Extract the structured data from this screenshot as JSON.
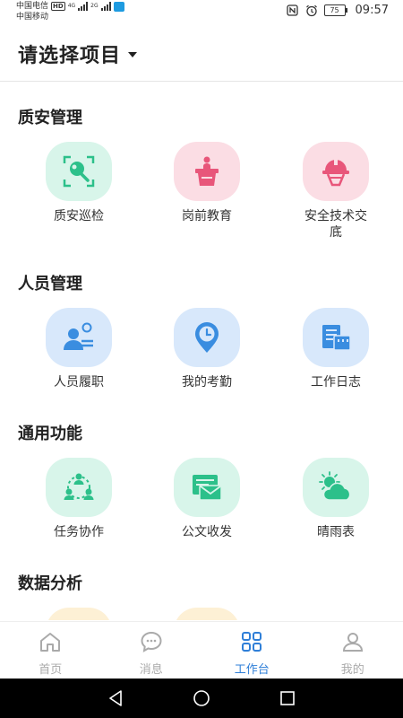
{
  "status_bar": {
    "carrier1": "中国电信",
    "carrier1_badge": "HD",
    "carrier1_net": "4G",
    "carrier2": "中国移动",
    "carrier2_net": "2G",
    "battery": "75",
    "time": "09:57"
  },
  "header": {
    "title": "请选择项目"
  },
  "sections": [
    {
      "title": "质安管理",
      "items": [
        {
          "label": "质安巡检",
          "icon": "inspect-icon"
        },
        {
          "label": "岗前教育",
          "icon": "podium-icon"
        },
        {
          "label": "安全技术交底",
          "icon": "hardhat-icon"
        }
      ]
    },
    {
      "title": "人员管理",
      "items": [
        {
          "label": "人员履职",
          "icon": "person-duty-icon"
        },
        {
          "label": "我的考勤",
          "icon": "attendance-icon"
        },
        {
          "label": "工作日志",
          "icon": "work-log-icon"
        }
      ]
    },
    {
      "title": "通用功能",
      "items": [
        {
          "label": "任务协作",
          "icon": "team-icon"
        },
        {
          "label": "公文收发",
          "icon": "document-mail-icon"
        },
        {
          "label": "晴雨表",
          "icon": "weather-icon"
        }
      ]
    },
    {
      "title": "数据分析",
      "items": []
    }
  ],
  "bottom_nav": [
    {
      "label": "首页",
      "icon": "home-icon"
    },
    {
      "label": "消息",
      "icon": "message-icon"
    },
    {
      "label": "工作台",
      "icon": "workbench-icon",
      "active": true
    },
    {
      "label": "我的",
      "icon": "profile-icon"
    }
  ],
  "colors": {
    "green": "#2cc08a",
    "pink": "#e8567a",
    "blue": "#3a8de0",
    "active": "#2f7fd8"
  }
}
